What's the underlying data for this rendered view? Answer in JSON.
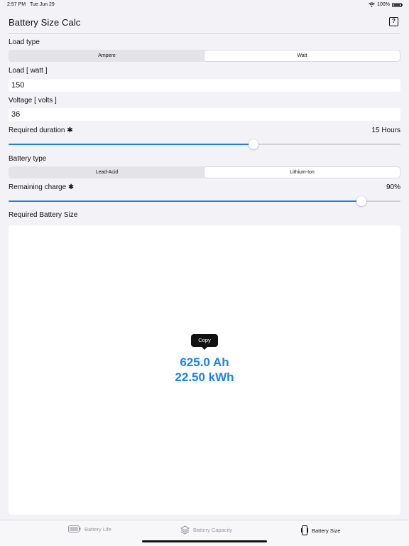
{
  "status_bar": {
    "time": "2:57 PM",
    "date": "Tue Jun 29",
    "battery_percent": "100%",
    "battery_level": 1.0
  },
  "header": {
    "title": "Battery Size Calc",
    "help_label": "?"
  },
  "load_type": {
    "label": "Load type",
    "options": [
      "Ampere",
      "Watt"
    ],
    "selected_index": 1
  },
  "load": {
    "label": "Load [ watt ]",
    "value": "150"
  },
  "voltage": {
    "label": "Voltage [ volts ]",
    "value": "36"
  },
  "duration": {
    "label": "Required duration ✱",
    "value_text": "15 Hours",
    "fraction": 0.625
  },
  "battery_type": {
    "label": "Battery type",
    "options": [
      "Lead-Acid",
      "Lithium-Ion"
    ],
    "selected_index": 1
  },
  "remaining_charge": {
    "label": "Remaining charge ✱",
    "value_text": "90%",
    "fraction": 0.9
  },
  "result": {
    "label": "Required Battery Size",
    "copy_label": "Copy",
    "ah": "625.0 Ah",
    "kwh": "22.50 kWh"
  },
  "tabs": [
    {
      "label": "Battery Life",
      "icon": "battery-icon",
      "active": false
    },
    {
      "label": "Battery Capacity",
      "icon": "layers-icon",
      "active": false
    },
    {
      "label": "Battery Size",
      "icon": "phone-resize-icon",
      "active": true
    }
  ],
  "colors": {
    "accent": "#1a82f0",
    "background": "#f2f2f7"
  }
}
